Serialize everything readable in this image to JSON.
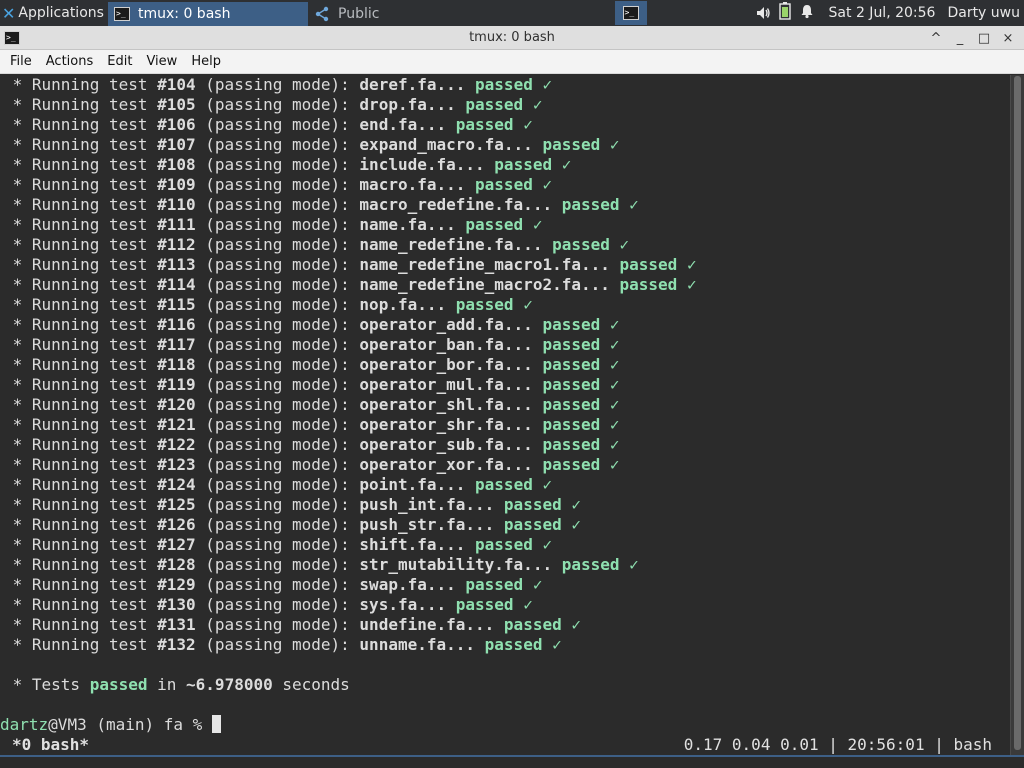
{
  "panel": {
    "applications_label": "Applications",
    "tasks": [
      {
        "label": "tmux: 0 bash",
        "active": true
      },
      {
        "label": "Public",
        "active": false
      }
    ],
    "clock": "Sat  2 Jul, 20:56",
    "user": "Darty uwu",
    "icons": [
      "xfce-icon",
      "terminal-icon",
      "share-icon",
      "volume-icon",
      "battery-icon",
      "notification-bell-icon"
    ]
  },
  "window": {
    "title": "tmux: 0 bash",
    "controls": [
      "^",
      "_",
      "□",
      "×"
    ]
  },
  "menubar": {
    "items": [
      "File",
      "Actions",
      "Edit",
      "View",
      "Help"
    ]
  },
  "colors": {
    "passed": "#8fe0b0",
    "accent": "#3d5f86",
    "terminal_bg": "#2b2b2b"
  },
  "terminal": {
    "prefix": " * Running test ",
    "mode": " (passing mode): ",
    "passed_word": "passed",
    "check": "✓",
    "tests": [
      {
        "num": "#104",
        "file": "deref.fa..."
      },
      {
        "num": "#105",
        "file": "drop.fa..."
      },
      {
        "num": "#106",
        "file": "end.fa..."
      },
      {
        "num": "#107",
        "file": "expand_macro.fa..."
      },
      {
        "num": "#108",
        "file": "include.fa..."
      },
      {
        "num": "#109",
        "file": "macro.fa..."
      },
      {
        "num": "#110",
        "file": "macro_redefine.fa..."
      },
      {
        "num": "#111",
        "file": "name.fa..."
      },
      {
        "num": "#112",
        "file": "name_redefine.fa..."
      },
      {
        "num": "#113",
        "file": "name_redefine_macro1.fa..."
      },
      {
        "num": "#114",
        "file": "name_redefine_macro2.fa..."
      },
      {
        "num": "#115",
        "file": "nop.fa..."
      },
      {
        "num": "#116",
        "file": "operator_add.fa..."
      },
      {
        "num": "#117",
        "file": "operator_ban.fa..."
      },
      {
        "num": "#118",
        "file": "operator_bor.fa..."
      },
      {
        "num": "#119",
        "file": "operator_mul.fa..."
      },
      {
        "num": "#120",
        "file": "operator_shl.fa..."
      },
      {
        "num": "#121",
        "file": "operator_shr.fa..."
      },
      {
        "num": "#122",
        "file": "operator_sub.fa..."
      },
      {
        "num": "#123",
        "file": "operator_xor.fa..."
      },
      {
        "num": "#124",
        "file": "point.fa..."
      },
      {
        "num": "#125",
        "file": "push_int.fa..."
      },
      {
        "num": "#126",
        "file": "push_str.fa..."
      },
      {
        "num": "#127",
        "file": "shift.fa..."
      },
      {
        "num": "#128",
        "file": "str_mutability.fa..."
      },
      {
        "num": "#129",
        "file": "swap.fa..."
      },
      {
        "num": "#130",
        "file": "sys.fa..."
      },
      {
        "num": "#131",
        "file": "undefine.fa..."
      },
      {
        "num": "#132",
        "file": "unname.fa..."
      }
    ],
    "summary": {
      "prefix": " * Tests ",
      "passed": "passed",
      "middle": " in ",
      "time": "~6.978000",
      "suffix": " seconds"
    },
    "prompt": {
      "user": "dartz",
      "rest": "@VM3 (main) fa % "
    }
  },
  "tmux": {
    "window": "*0 bash*",
    "status_right": "0.17 0.04 0.01 | 20:56:01 | bash"
  }
}
